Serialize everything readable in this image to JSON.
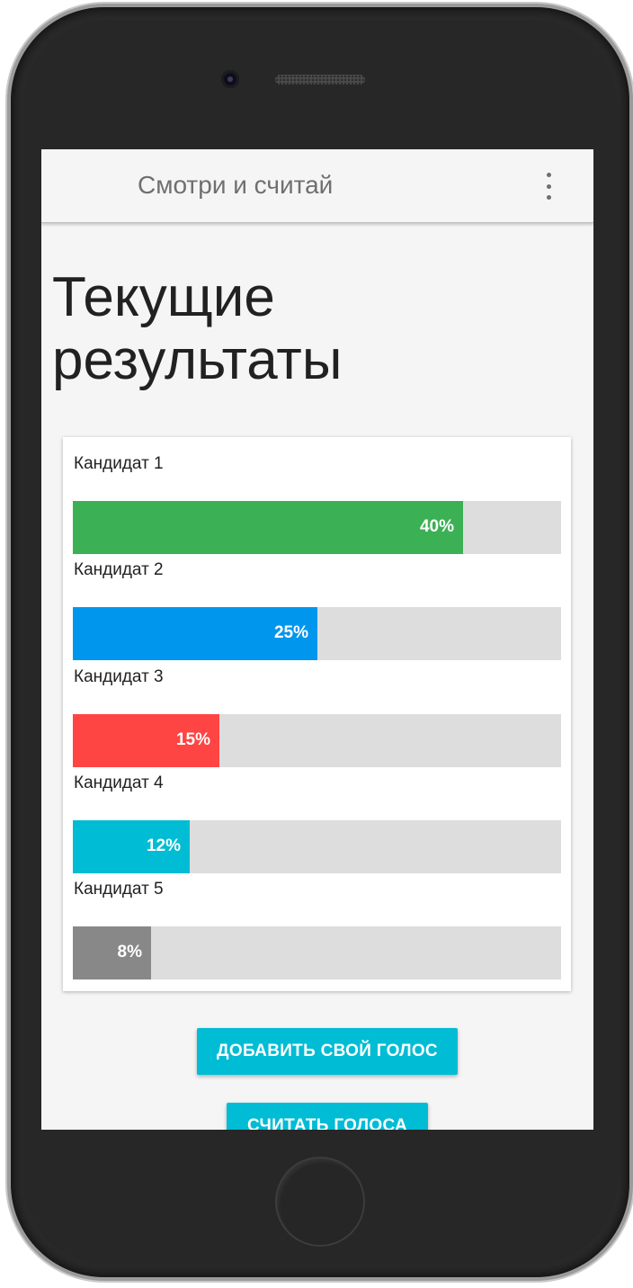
{
  "app_bar": {
    "title": "Смотри и считай",
    "menu_icon": "more-vert-icon"
  },
  "page": {
    "heading": "Текущие результаты"
  },
  "results": [
    {
      "label": "Кандидат 1",
      "percent_text": "40%",
      "fraction": 0.4,
      "color": "#3cb054"
    },
    {
      "label": "Кандидат 2",
      "percent_text": "25%",
      "fraction": 0.25,
      "color": "#0096ee"
    },
    {
      "label": "Кандидат 3",
      "percent_text": "15%",
      "fraction": 0.15,
      "color": "#ff4444"
    },
    {
      "label": "Кандидат 4",
      "percent_text": "12%",
      "fraction": 0.12,
      "color": "#00bcd4"
    },
    {
      "label": "Кандидат 5",
      "percent_text": "8%",
      "fraction": 0.08,
      "color": "#888888"
    }
  ],
  "buttons": {
    "add_vote": "ДОБАВИТЬ СВОЙ ГОЛОС",
    "count_votes": "СЧИТАТЬ ГОЛОСА"
  },
  "colors": {
    "accent": "#00bcd4",
    "track": "#dddddd",
    "screen_bg": "#f5f5f5"
  }
}
